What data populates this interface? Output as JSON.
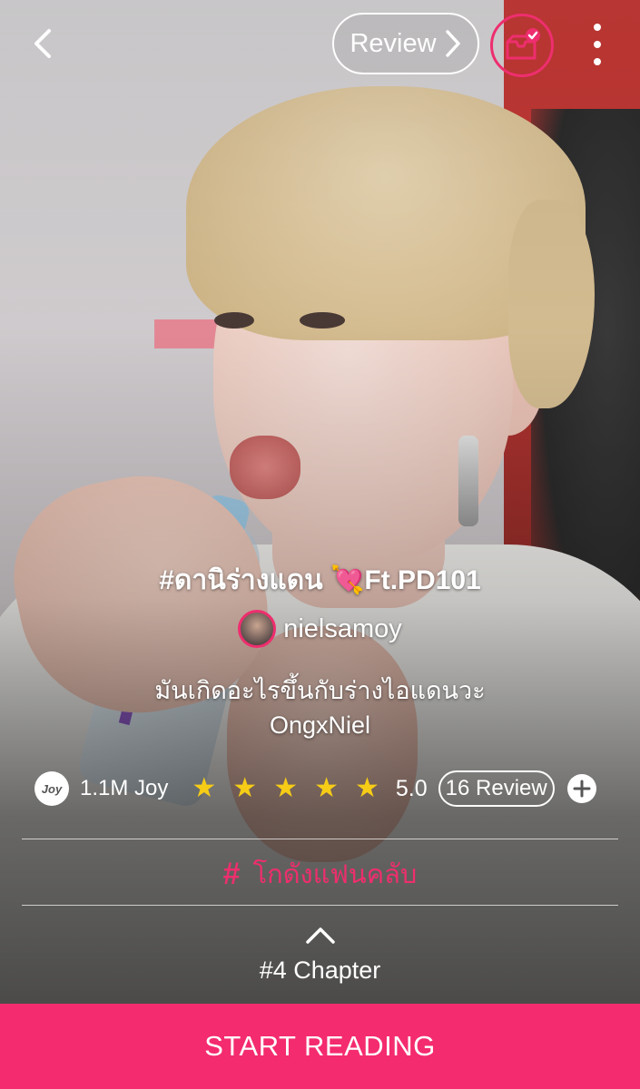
{
  "topbar": {
    "review_label": "Review",
    "icons": [
      "back-arrow-icon",
      "chevron-right-icon",
      "library-check-icon",
      "more-vertical-icon"
    ]
  },
  "story": {
    "title": "#ดานิร่างแดน 💘Ft.PD101",
    "author": "nielsamoy",
    "description_line1": "มันเกิดอะไรขึ้นกับร่างไอแดนวะ",
    "description_line2": "OngxNiel"
  },
  "stats": {
    "joy_badge": "Joy",
    "joy_count": "1.1M Joy",
    "stars": 5,
    "rating": "5.0",
    "review_count": "16 Review"
  },
  "tag": {
    "symbol": "#",
    "label": "โกดังแฟนคลับ"
  },
  "chapter": {
    "label": "#4 Chapter"
  },
  "cta": {
    "label": "START READING"
  },
  "colors": {
    "accent": "#f42b6e",
    "star": "#f6cc16"
  }
}
